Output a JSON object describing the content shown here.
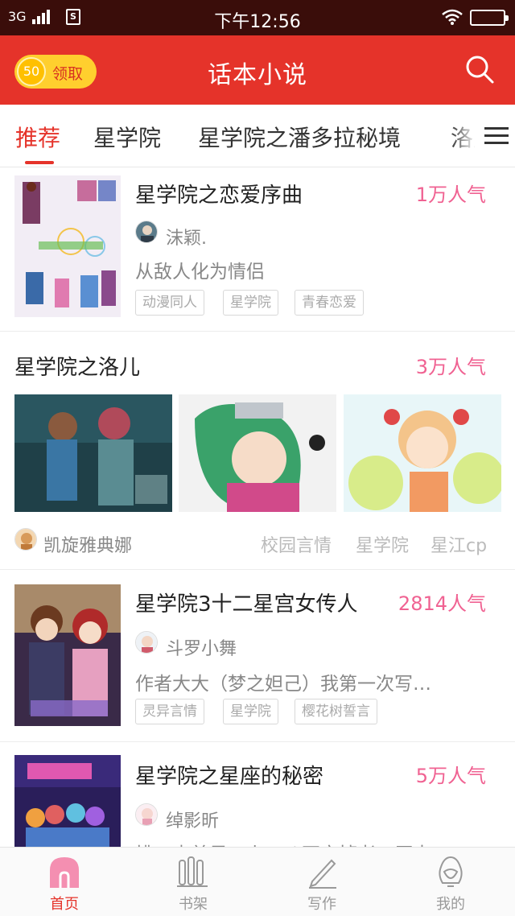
{
  "status_bar": {
    "network": "3G",
    "sim": "S",
    "time": "下午12:56"
  },
  "header": {
    "coin_count": "50",
    "coin_label": "领取",
    "title": "话本小说",
    "search_icon": "search-icon"
  },
  "tabs": [
    {
      "label": "推荐",
      "active": true
    },
    {
      "label": "星学院"
    },
    {
      "label": "星学院之潘多拉秘境"
    },
    {
      "label": "洛儿"
    }
  ],
  "feed": {
    "card1": {
      "title": "星学院之恋爱序曲",
      "popularity": "1万人气",
      "author": "沫颖.",
      "description": "从敌人化为情侣",
      "tags": [
        "动漫同人",
        "星学院",
        "青春恋爱"
      ]
    },
    "card2": {
      "title": "星学院之洛儿",
      "popularity": "3万人气",
      "author": "凯旋雅典娜",
      "tags": [
        "校园言情",
        "星学院",
        "星江cp"
      ]
    },
    "card3": {
      "title": "星学院3十二星宫女传人",
      "popularity": "2814人气",
      "author": "斗罗小舞",
      "description": "作者大大（梦之妲己）我第一次写…",
      "tags": [
        "灵异言情",
        "星学院",
        "樱花树誓言"
      ]
    },
    "card4": {
      "title": "星学院之星座的秘密",
      "popularity": "5万人气",
      "author": "绰影昕",
      "description": "桃、查美是，上二八不完掉者，原吉"
    }
  },
  "bottom_nav": [
    {
      "label": "首页",
      "icon": "home-icon",
      "active": true
    },
    {
      "label": "书架",
      "icon": "bookshelf-icon"
    },
    {
      "label": "写作",
      "icon": "pen-icon"
    },
    {
      "label": "我的",
      "icon": "profile-icon"
    }
  ],
  "colors": {
    "brand_red": "#e5332a",
    "popularity_pink": "#f06292",
    "coin_yellow": "#ffcf2e"
  }
}
